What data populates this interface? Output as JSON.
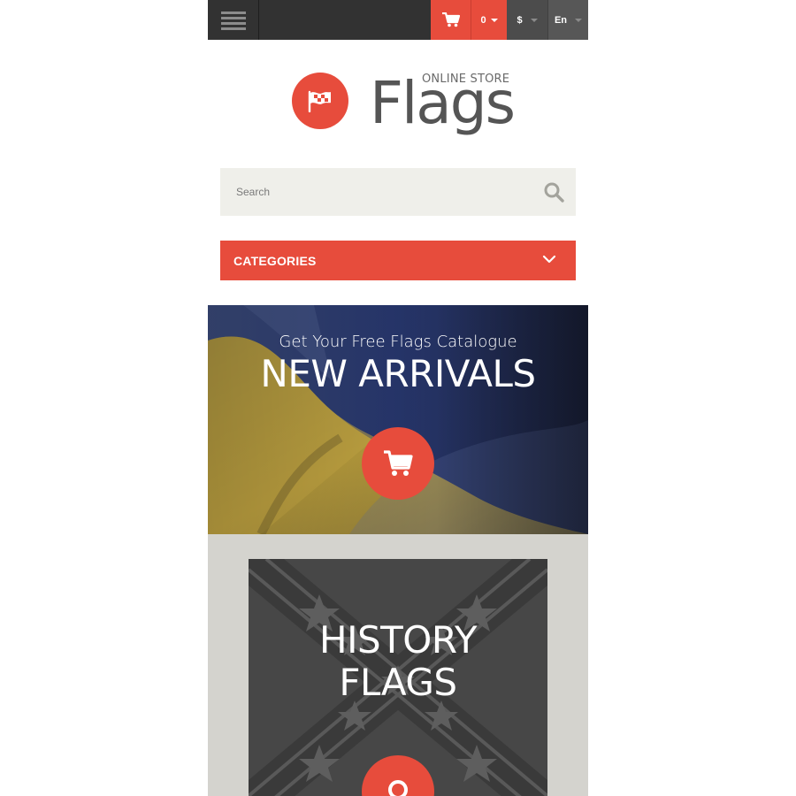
{
  "topbar": {
    "menu_icon": "hamburger-icon",
    "cart_icon": "cart-icon",
    "cart_count": "0",
    "currency": "$",
    "language": "En"
  },
  "logo": {
    "subtitle": "ONLINE STORE",
    "name": "Flags",
    "icon": "flag-icon"
  },
  "search": {
    "placeholder": "Search",
    "icon": "search-icon"
  },
  "categories": {
    "label": "CATEGORIES",
    "icon": "chevron-down-icon"
  },
  "banners": [
    {
      "subtitle": "Get Your Free Flags Catalogue",
      "title": "NEW ARRIVALS",
      "icon": "cart-icon"
    },
    {
      "title_line1": "HISTORY",
      "title_line2": "FLAGS",
      "icon": "location-pin-icon"
    }
  ],
  "colors": {
    "accent": "#e74c3c",
    "topbar": "#323232",
    "search_bg": "#efefea",
    "logo_text": "#555555"
  }
}
